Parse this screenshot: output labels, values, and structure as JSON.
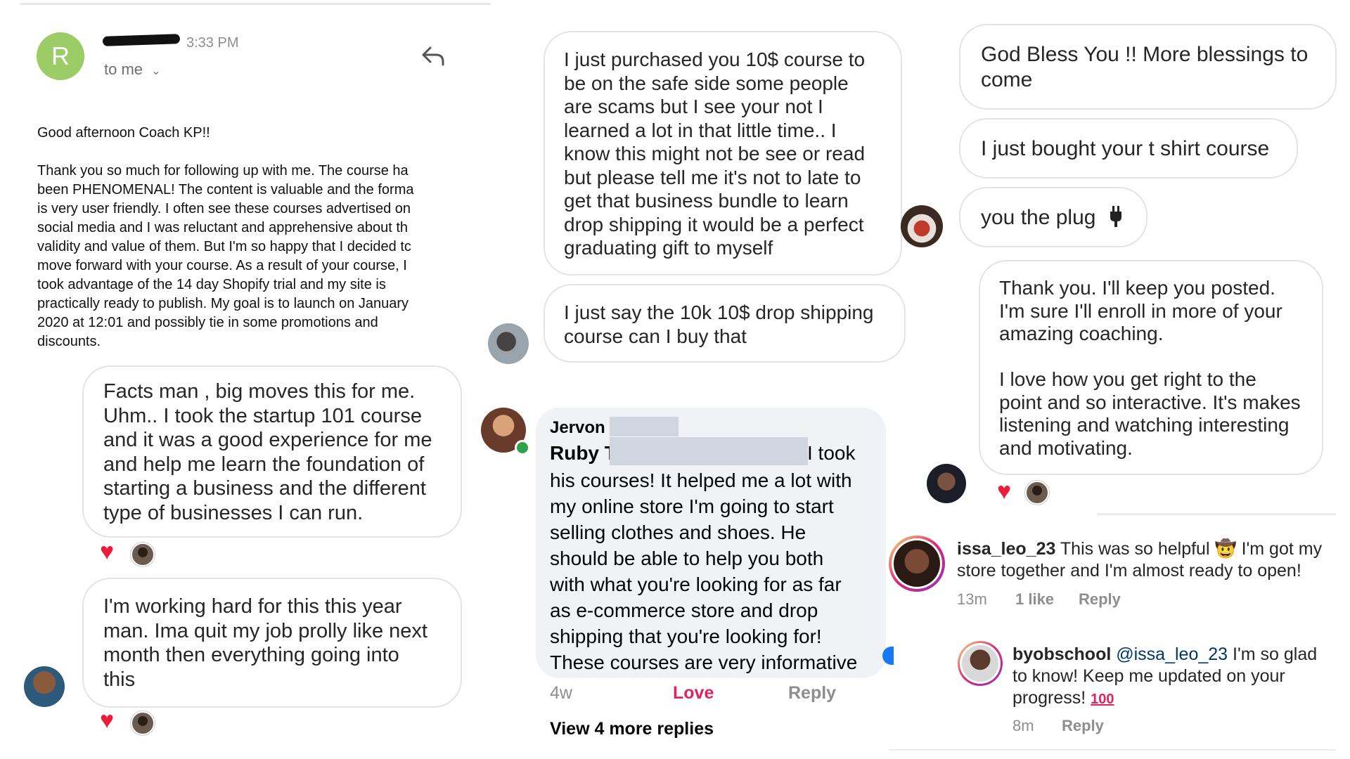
{
  "email": {
    "avatar_letter": "R",
    "time": "3:33 PM",
    "to_label": "to me",
    "greeting": "Good afternoon Coach KP!!",
    "body_lines": [
      "Thank you so much for following up with me.  The course ha",
      "been PHENOMENAL!  The content is valuable and the forma",
      "is very user friendly.  I often see these courses advertised on",
      "social media and I  was reluctant and apprehensive about th",
      "validity and value of them.  But I'm so happy that I decided tc",
      "move forward with your course. As a result of your course, I",
      "took advantage of the 14 day Shopify trial and my site is",
      "practically ready to publish. My goal is to launch on January",
      "2020 at 12:01 and possibly tie in some promotions and",
      "discounts."
    ]
  },
  "dm_left": {
    "msg1": "Facts man , big moves this for me.\nUhm.. I took the startup 101 course\nand it was a good experience for me\nand help me learn the foundation of\nstarting a business and the different\ntype of businesses I can run.",
    "msg2": "I'm working hard for this this year\nman. Ima quit my job prolly like next\nmonth then everything going into\nthis"
  },
  "dm_middle": {
    "msg1": "I just purchased you 10$ course to\nbe on the safe side some people\nare scams but I see your not I\nlearned a lot in that little time.. I\nknow this might not be see or read\nbut please tell me it's not to late to\nget that business bundle to learn\ndrop shipping it would be a perfect\ngraduating gift to myself",
    "msg2": "I just say the 10k 10$ drop shipping\ncourse can I buy that"
  },
  "fb_comment": {
    "author": "Jervon",
    "mention_start": "Ruby T",
    "mention_tail": "I took",
    "text": "his courses! It helped me a lot with\nmy online store I'm going to start\nselling clothes and shoes.  He\nshould be able to help you both\nwith what you're looking for as far\nas e-commerce store and drop\nshipping that you're looking for!\nThese courses are very informative",
    "age": "4w",
    "love": "Love",
    "reply": "Reply",
    "more_replies": "View 4 more replies"
  },
  "dm_right": {
    "msg1": "God Bless You !! More blessings to\ncome",
    "msg2": "I just bought your t shirt course",
    "msg3": "you the plug",
    "msg4": "Thank you. I'll keep you posted.\nI'm sure I'll enroll in more of your\namazing coaching.\n\nI love how you get right to the\npoint and so interactive. It's makes\nlistening and watching interesting\nand motivating."
  },
  "ig_comment": {
    "user": "issa_leo_23",
    "text_a": "This was so helpful",
    "text_b": "I'm got my",
    "text_c": "store together and I'm almost ready to open!",
    "age": "13m",
    "likes": "1 like",
    "reply": "Reply"
  },
  "ig_reply": {
    "user": "byobschool",
    "mention": "@issa_leo_23",
    "text_a": "I'm so glad",
    "text_b": "to know! Keep me updated on your",
    "text_c": "progress!",
    "age": "8m",
    "reply": "Reply"
  },
  "colors": {
    "heart": "#ed1c3a",
    "link": "#00376b",
    "love": "#e0245e",
    "email_avatar": "#9ccc65"
  }
}
